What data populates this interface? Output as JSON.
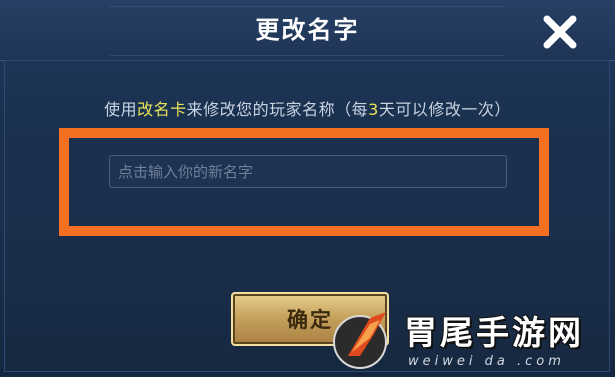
{
  "dialog": {
    "title": "更改名字",
    "hint": {
      "prefix": "使用",
      "item": "改名卡",
      "middle": "来修改您的玩家名称（每",
      "count": "3",
      "suffix": "天可以修改一次）"
    },
    "name_input": {
      "placeholder": "点击输入你的新名字",
      "value": ""
    },
    "confirm_label": "确定",
    "close_icon": "close-x-icon"
  },
  "watermark": {
    "name": "胃尾手游网",
    "url": "weiwei da  .com"
  },
  "colors": {
    "highlight": "#e8e35a",
    "annotation_box": "#f36f22",
    "button_gold": "#c7a35d",
    "panel_bg": "#1b3150"
  }
}
